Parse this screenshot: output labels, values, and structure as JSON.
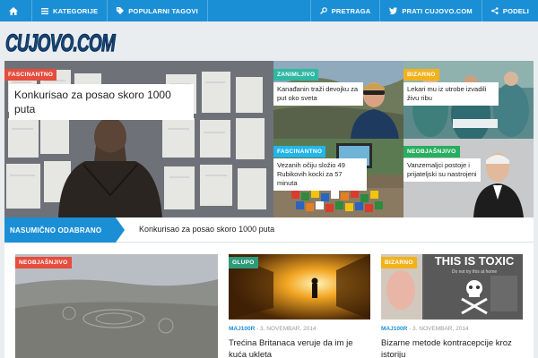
{
  "nav": {
    "kategorije": "KATEGORIJE",
    "popularni": "POPULARNI TAGOVI",
    "pretraga": "PRETRAGA",
    "prati": "PRATI CUJOVO.COM",
    "podeli": "PODELI"
  },
  "logo": {
    "text": "CUJOVO.COM"
  },
  "hero": {
    "main": {
      "category": "FASCINANTNO",
      "title": "Konkurisao za posao skoro 1000 puta",
      "cat_color": "#e74c3c"
    },
    "t1": {
      "category": "ZANIMLJIVO",
      "title": "Kanađanin traži devojku za put oko sveta",
      "cat_color": "#2fb9a4"
    },
    "t2": {
      "category": "BIZARNO",
      "title": "Lekari mu iz utrobe izvadili živu ribu",
      "cat_color": "#f3b21b"
    },
    "t3": {
      "category": "FASCINANTNO",
      "title": "Vezanih očiju složio 49 Rubikovih kocki za 57 minuta",
      "cat_color": "#22b6e8"
    },
    "t4": {
      "category": "NEOBJAŠNJIVO",
      "title": "Vanzemaljci postoje i prijateljski su nastrojeni",
      "cat_color": "#27ae60"
    }
  },
  "random": {
    "label": "NASUMIČNO ODABRANO",
    "title": "Konkurisao za posao skoro 1000 puta"
  },
  "cards": [
    {
      "category": "NEOBJAŠNJIVO",
      "cat_color": "#e74c3c",
      "author": "",
      "date": "",
      "title": ""
    },
    {
      "category": "GLUPO",
      "cat_color": "#2e9b7b",
      "author": "MAJ100R",
      "date": "3. NOVEMBAR, 2014",
      "title": "Trećina Britanaca veruje da im je kuća ukleta"
    },
    {
      "category": "BIZARNO",
      "cat_color": "#f3b21b",
      "author": "MAJ100R",
      "date": "3. NOVEMBAR, 2014",
      "title": "Bizarne metode kontracepcije kroz istoriju",
      "image_text": "THIS IS TOXIC",
      "image_subtext": "Do not try this at home"
    }
  ]
}
